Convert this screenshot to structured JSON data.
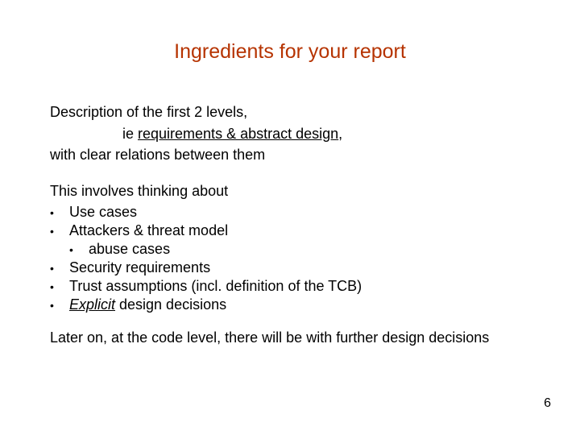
{
  "title": "Ingredients for your report",
  "intro": {
    "line1": "Description of the first 2 levels,",
    "line2_pre": "ie ",
    "line2_underlined": "requirements & abstract design",
    "line2_post": ",",
    "line3": "with clear relations between them"
  },
  "involves": {
    "heading": "This involves thinking about",
    "items": [
      "Use cases",
      "Attackers & threat model",
      "abuse cases",
      "Security requirements",
      "Trust assumptions  (incl. definition of the TCB)"
    ],
    "explicit": {
      "word": "Explicit",
      "rest": "  design decisions"
    }
  },
  "closing": "Later on, at the code level, there will be with further design decisions",
  "page_number": "6"
}
